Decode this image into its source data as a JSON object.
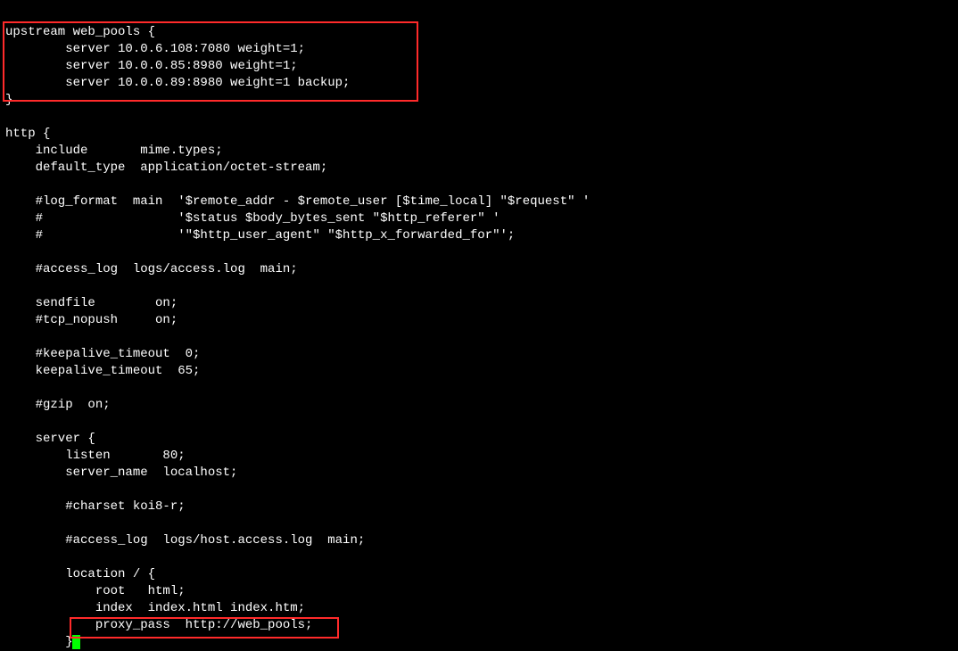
{
  "lines": {
    "l0": "",
    "l1": "upstream web_pools {",
    "l2": "        server 10.0.6.108:7080 weight=1;",
    "l3": "        server 10.0.0.85:8980 weight=1;",
    "l4": "        server 10.0.0.89:8980 weight=1 backup;",
    "l5": "}",
    "l6": "",
    "l7": "http {",
    "l8": "    include       mime.types;",
    "l9": "    default_type  application/octet-stream;",
    "l10": "",
    "l11": "    #log_format  main  '$remote_addr - $remote_user [$time_local] \"$request\" '",
    "l12": "    #                  '$status $body_bytes_sent \"$http_referer\" '",
    "l13": "    #                  '\"$http_user_agent\" \"$http_x_forwarded_for\"';",
    "l14": "",
    "l15": "    #access_log  logs/access.log  main;",
    "l16": "",
    "l17": "    sendfile        on;",
    "l18": "    #tcp_nopush     on;",
    "l19": "",
    "l20": "    #keepalive_timeout  0;",
    "l21": "    keepalive_timeout  65;",
    "l22": "",
    "l23": "    #gzip  on;",
    "l24": "",
    "l25": "    server {",
    "l26": "        listen       80;",
    "l27": "        server_name  localhost;",
    "l28": "",
    "l29": "        #charset koi8-r;",
    "l30": "",
    "l31": "        #access_log  logs/host.access.log  main;",
    "l32": "",
    "l33": "        location / {",
    "l34": "            root   html;",
    "l35": "            index  index.html index.htm;",
    "l36": "            proxy_pass  http://web_pools;",
    "l37": "        }"
  }
}
